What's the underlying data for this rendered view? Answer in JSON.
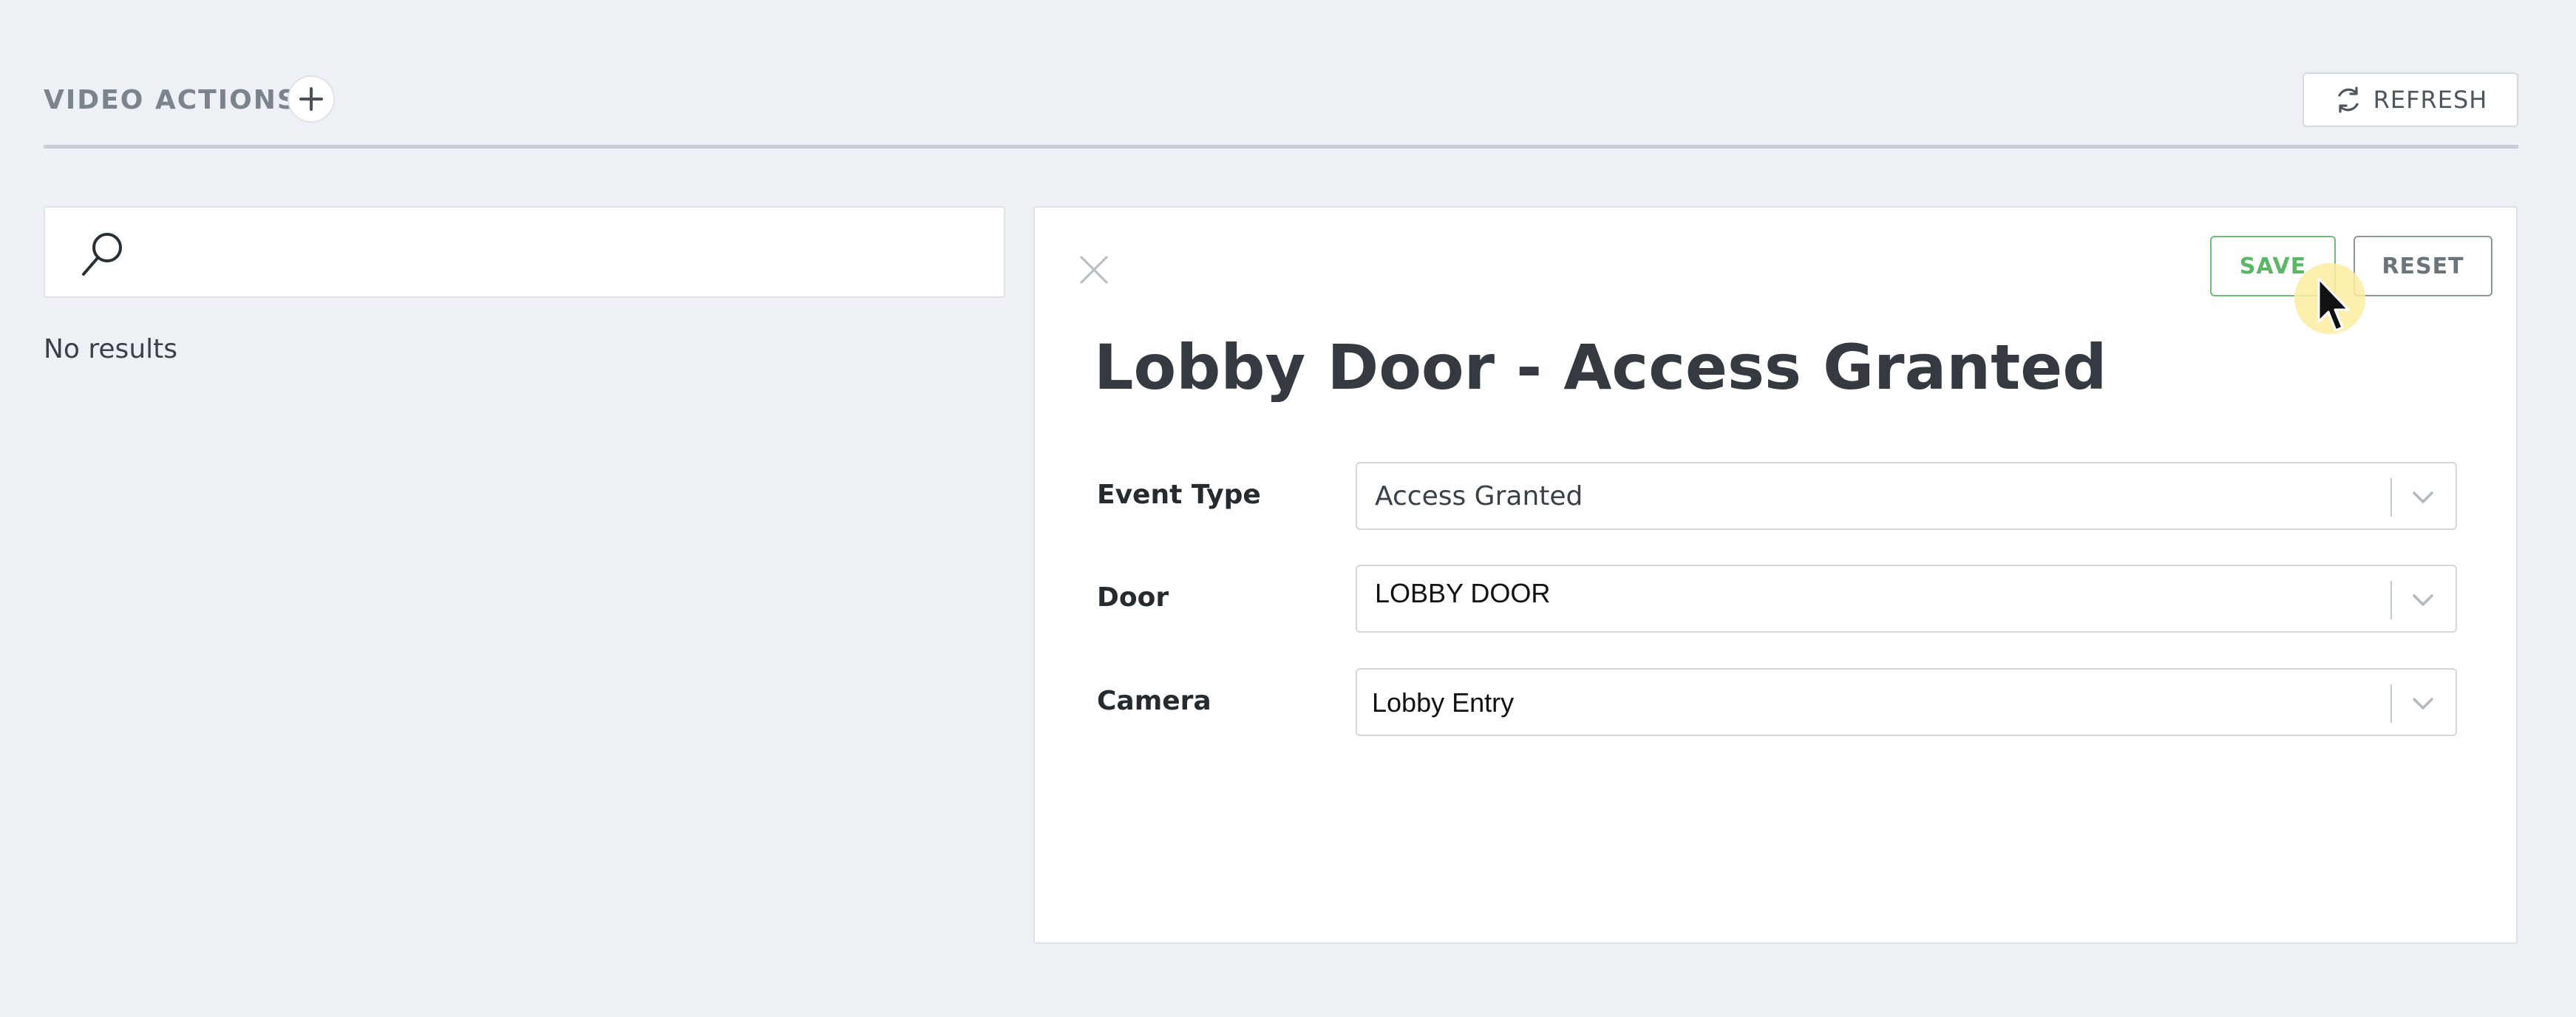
{
  "header": {
    "title": "VIDEO ACTIONS",
    "add_icon": "plus-icon",
    "refresh_label": "REFRESH",
    "refresh_icon": "refresh-icon"
  },
  "search": {
    "value": "",
    "placeholder": "",
    "icon": "search-icon"
  },
  "results": {
    "empty_text": "No results"
  },
  "detail": {
    "title": "Lobby Door - Access Granted",
    "close_icon": "close-icon",
    "save_label": "SAVE",
    "reset_label": "RESET",
    "fields": [
      {
        "label": "Event Type",
        "value": "Access Granted"
      },
      {
        "label": "Door",
        "value": "LOBBY DOOR"
      },
      {
        "label": "Camera",
        "value": "Lobby Entry"
      }
    ]
  },
  "colors": {
    "background": "#edf0f4",
    "save_accent": "#5cb866",
    "reset_border": "#8d949b",
    "cursor_highlight": "#fdeca0"
  }
}
